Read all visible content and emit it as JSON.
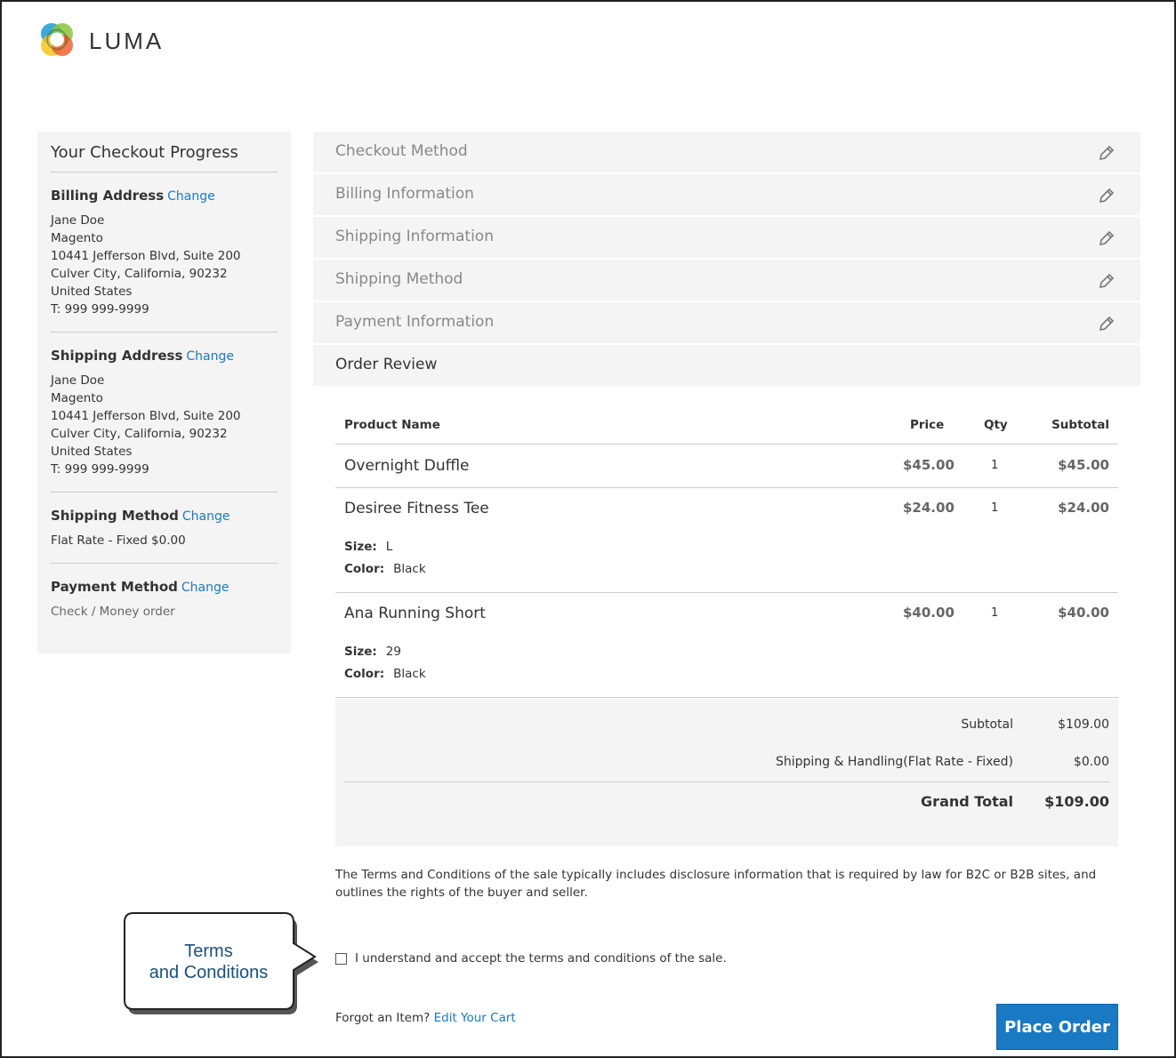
{
  "brand": {
    "name": "LUMA"
  },
  "sidebar": {
    "title": "Your Checkout Progress",
    "change_label": "Change",
    "billing": {
      "heading": "Billing Address",
      "lines": [
        "Jane Doe",
        "Magento",
        "10441 Jefferson Blvd, Suite 200",
        "Culver City, California, 90232",
        "United States",
        "T: 999 999-9999"
      ]
    },
    "shipping": {
      "heading": "Shipping Address",
      "lines": [
        "Jane Doe",
        "Magento",
        "10441 Jefferson Blvd, Suite 200",
        "Culver City, California, 90232",
        "United States",
        "T: 999 999-9999"
      ]
    },
    "shipping_method": {
      "heading": "Shipping Method",
      "value": "Flat Rate - Fixed $0.00"
    },
    "payment_method": {
      "heading": "Payment Method",
      "value": "Check / Money order"
    }
  },
  "steps": [
    {
      "label": "Checkout Method"
    },
    {
      "label": "Billing Information"
    },
    {
      "label": "Shipping Information"
    },
    {
      "label": "Shipping Method"
    },
    {
      "label": "Payment Information"
    },
    {
      "label": "Order Review"
    }
  ],
  "table": {
    "headers": {
      "name": "Product Name",
      "price": "Price",
      "qty": "Qty",
      "subtotal": "Subtotal"
    },
    "size_label": "Size:",
    "color_label": "Color:",
    "items": [
      {
        "name": "Overnight Duffle",
        "price": "$45.00",
        "qty": "1",
        "subtotal": "$45.00"
      },
      {
        "name": "Desiree Fitness Tee",
        "price": "$24.00",
        "qty": "1",
        "subtotal": "$24.00",
        "size": "L",
        "color": "Black"
      },
      {
        "name": "Ana Running Short",
        "price": "$40.00",
        "qty": "1",
        "subtotal": "$40.00",
        "size": "29",
        "color": "Black"
      }
    ]
  },
  "totals": {
    "subtotal_label": "Subtotal",
    "subtotal_value": "$109.00",
    "shipping_label": "Shipping & Handling(Flat Rate - Fixed)",
    "shipping_value": "$0.00",
    "grand_label": "Grand Total",
    "grand_value": "$109.00"
  },
  "terms": {
    "text": "The Terms and Conditions of the sale typically includes disclosure information that is required by law for B2C or B2B sites, and outlines the rights of the buyer and seller.",
    "agree_label": "I understand and accept the terms and conditions of the sale."
  },
  "footer": {
    "forgot_label": "Forgot an Item?",
    "edit_cart_label": "Edit Your Cart",
    "place_order_label": "Place Order"
  },
  "callout": {
    "line1": "Terms",
    "line2": "and Conditions"
  },
  "colors": {
    "accent": "#1979c3",
    "panel": "#f4f4f4",
    "callout_text": "#1a4f7a"
  }
}
